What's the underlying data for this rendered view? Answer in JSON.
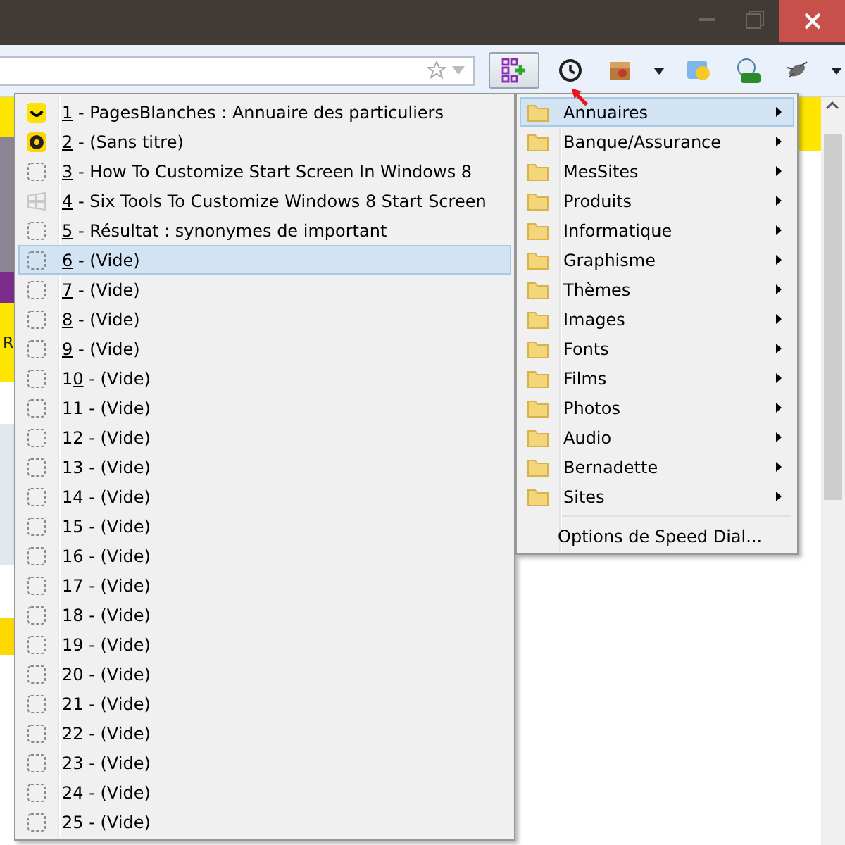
{
  "window": {
    "controls": [
      {
        "kind": "minimize"
      },
      {
        "kind": "maximize"
      },
      {
        "kind": "close"
      }
    ]
  },
  "toolbar": {
    "items": [
      {
        "kind": "speeddial",
        "selected": true
      },
      {
        "kind": "history",
        "selected": false
      },
      {
        "kind": "box",
        "selected": false
      },
      {
        "kind": "caret",
        "selected": false
      },
      {
        "kind": "weather",
        "selected": false
      },
      {
        "kind": "on",
        "selected": false
      },
      {
        "kind": "bug",
        "selected": false
      },
      {
        "kind": "caret",
        "selected": false
      }
    ]
  },
  "page_fragments": [
    "R"
  ],
  "speed_dial_menu": {
    "items": [
      {
        "kind": "smiley",
        "accesskey": "1",
        "title": "- PagesBlanches : Annuaire des particuliers",
        "selected": false
      },
      {
        "kind": "coin",
        "accesskey": "2",
        "title": "- (Sans titre)",
        "selected": false
      },
      {
        "kind": "empty",
        "accesskey": "3",
        "title": "- How To Customize Start Screen In Windows 8",
        "selected": false
      },
      {
        "kind": "windows",
        "accesskey": "4",
        "title": "- Six Tools To Customize Windows 8 Start Screen",
        "selected": false
      },
      {
        "kind": "empty",
        "accesskey": "5",
        "title": "- Résultat : synonymes de important",
        "selected": false
      },
      {
        "kind": "empty",
        "accesskey": "6",
        "title": "- (Vide)",
        "selected": true
      },
      {
        "kind": "empty",
        "accesskey": "7",
        "title": "- (Vide)",
        "selected": false
      },
      {
        "kind": "empty",
        "accesskey": "8",
        "title": "- (Vide)",
        "selected": false
      },
      {
        "kind": "empty",
        "accesskey": "9",
        "title": "- (Vide)",
        "selected": false
      },
      {
        "kind": "empty",
        "number_lead": "1",
        "accesskey": "0",
        "title": "- (Vide)",
        "selected": false
      },
      {
        "kind": "empty",
        "number": "11",
        "title": "- (Vide)",
        "selected": false
      },
      {
        "kind": "empty",
        "number": "12",
        "title": "- (Vide)",
        "selected": false
      },
      {
        "kind": "empty",
        "number": "13",
        "title": "- (Vide)",
        "selected": false
      },
      {
        "kind": "empty",
        "number": "14",
        "title": "- (Vide)",
        "selected": false
      },
      {
        "kind": "empty",
        "number": "15",
        "title": "- (Vide)",
        "selected": false
      },
      {
        "kind": "empty",
        "number": "16",
        "title": "- (Vide)",
        "selected": false
      },
      {
        "kind": "empty",
        "number": "17",
        "title": "- (Vide)",
        "selected": false
      },
      {
        "kind": "empty",
        "number": "18",
        "title": "- (Vide)",
        "selected": false
      },
      {
        "kind": "empty",
        "number": "19",
        "title": "- (Vide)",
        "selected": false
      },
      {
        "kind": "empty",
        "number": "20",
        "title": "- (Vide)",
        "selected": false
      },
      {
        "kind": "empty",
        "number": "21",
        "title": "- (Vide)",
        "selected": false
      },
      {
        "kind": "empty",
        "number": "22",
        "title": "- (Vide)",
        "selected": false
      },
      {
        "kind": "empty",
        "number": "23",
        "title": "- (Vide)",
        "selected": false
      },
      {
        "kind": "empty",
        "number": "24",
        "title": "- (Vide)",
        "selected": false
      },
      {
        "kind": "empty",
        "number": "25",
        "title": "- (Vide)",
        "selected": false
      }
    ]
  },
  "folder_menu": {
    "items": [
      {
        "label": "Annuaires",
        "selected": true
      },
      {
        "label": "Banque/Assurance",
        "selected": false
      },
      {
        "label": "MesSites",
        "selected": false
      },
      {
        "label": "Produits",
        "selected": false
      },
      {
        "label": "Informatique",
        "selected": false
      },
      {
        "label": "Graphisme",
        "selected": false
      },
      {
        "label": "Thèmes",
        "selected": false
      },
      {
        "label": "Images",
        "selected": false
      },
      {
        "label": "Fonts",
        "selected": false
      },
      {
        "label": "Films",
        "selected": false
      },
      {
        "label": "Photos",
        "selected": false
      },
      {
        "label": "Audio",
        "selected": false
      },
      {
        "label": "Bernadette",
        "selected": false
      },
      {
        "label": "Sites",
        "selected": false
      }
    ],
    "options": "Options de Speed Dial..."
  }
}
